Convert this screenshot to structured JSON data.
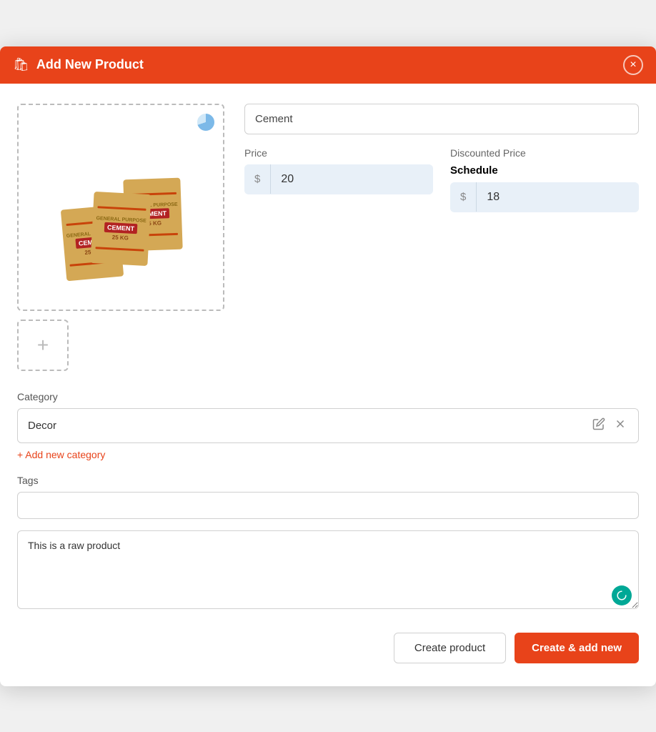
{
  "header": {
    "title": "Add New Product",
    "icon": "🛍",
    "close_label": "×"
  },
  "form": {
    "product_name": {
      "value": "Cement",
      "placeholder": "Product name"
    },
    "price": {
      "label": "Price",
      "currency": "$",
      "value": "20"
    },
    "discounted_price": {
      "label": "Discounted Price",
      "schedule_label": "Schedule",
      "currency": "$",
      "value": "18"
    },
    "category": {
      "label": "Category",
      "value": "Decor",
      "add_link": "+ Add new category"
    },
    "tags": {
      "label": "Tags",
      "value": "",
      "placeholder": ""
    },
    "description": {
      "value": "This is a raw product"
    }
  },
  "footer": {
    "create_label": "Create product",
    "create_add_label": "Create & add new"
  }
}
